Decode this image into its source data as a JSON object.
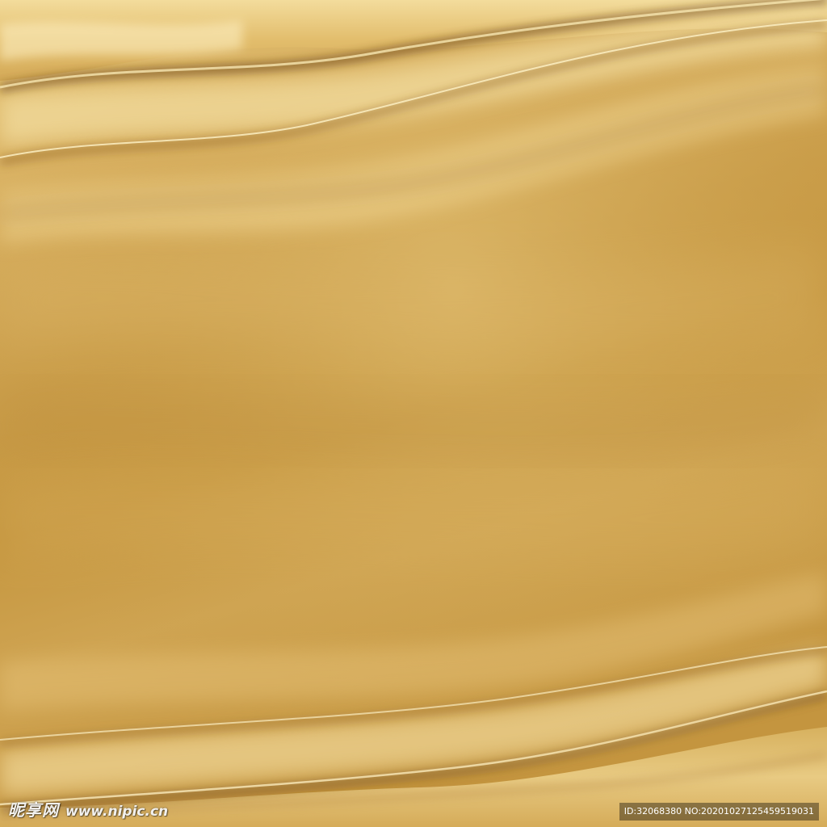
{
  "scene": {
    "subject": "gold-silk-fabric-background",
    "colors": {
      "base": "#c89a45",
      "highlight": "#f6e3a8",
      "shadow": "#8a5a1c",
      "deep_shadow": "#6b4212"
    }
  },
  "watermark": {
    "brand": "昵享网",
    "site": "www.nipic.cn",
    "id_line": "ID:32068380 NO:20201027125459519031"
  }
}
